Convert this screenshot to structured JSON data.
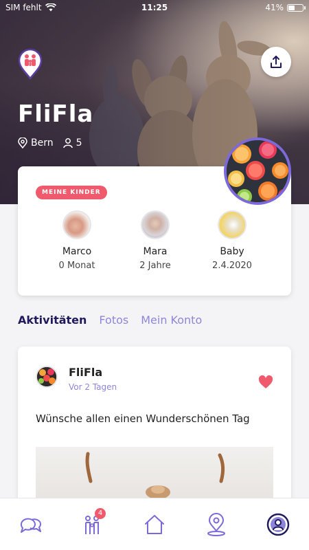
{
  "status_bar": {
    "carrier": "SIM fehlt",
    "time": "11:25",
    "battery": "41%",
    "battery_level": 0.41
  },
  "group": {
    "name": "FliFla",
    "location": "Bern",
    "members": "5"
  },
  "kids_section": {
    "badge": "MEINE KINDER",
    "kids": [
      {
        "name": "Marco",
        "info": "0 Monat"
      },
      {
        "name": "Mara",
        "info": "2 Jahre"
      },
      {
        "name": "Baby",
        "info": "2.4.2020"
      }
    ]
  },
  "tabs": [
    {
      "label": "Aktivitäten",
      "active": true
    },
    {
      "label": "Fotos",
      "active": false
    },
    {
      "label": "Mein Konto",
      "active": false
    }
  ],
  "post": {
    "author": "FliFla",
    "time": "Vor 2 Tagen",
    "text": "Wünsche allen einen Wunderschönen Tag",
    "liked": true
  },
  "bottom_nav": {
    "items": [
      {
        "icon": "chat-icon"
      },
      {
        "icon": "family-icon",
        "badge": "4"
      },
      {
        "icon": "home-icon"
      },
      {
        "icon": "map-pin-icon"
      },
      {
        "icon": "profile-icon",
        "active": true
      }
    ]
  },
  "colors": {
    "accent": "#7d6ad8",
    "dark": "#1e1a5c",
    "badge": "#ef5b6c"
  }
}
